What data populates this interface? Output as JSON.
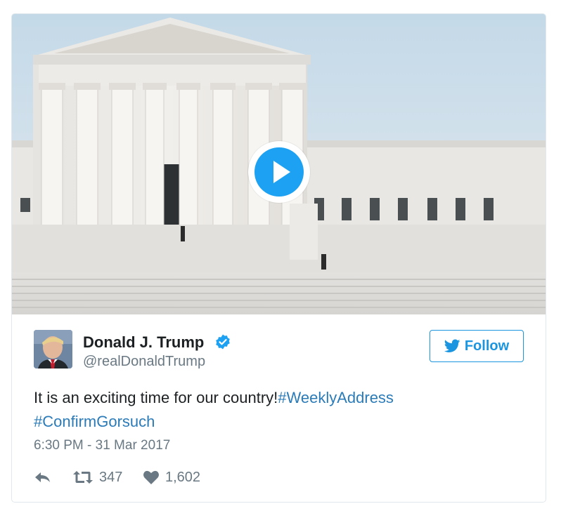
{
  "media": {
    "kind": "video",
    "subject": "Supreme Court building",
    "play_icon": "play-icon",
    "accent_color": "#1da1f2"
  },
  "author": {
    "name": "Donald J. Trump",
    "handle": "@realDonaldTrump",
    "verified_icon": "verified-badge-icon"
  },
  "follow": {
    "label": "Follow",
    "icon": "twitter-bird-icon",
    "color": "#1b95e0"
  },
  "tweet": {
    "text": "It is an exciting time for our country!",
    "hashtags": [
      "#WeeklyAddress",
      "#ConfirmGorsuch"
    ],
    "link_color": "#2b7bb9",
    "timestamp": "6:30 PM - 31 Mar 2017"
  },
  "actions": {
    "reply_icon": "reply-icon",
    "retweet_icon": "retweet-icon",
    "retweet_count": "347",
    "like_icon": "heart-icon",
    "like_count": "1,602"
  }
}
